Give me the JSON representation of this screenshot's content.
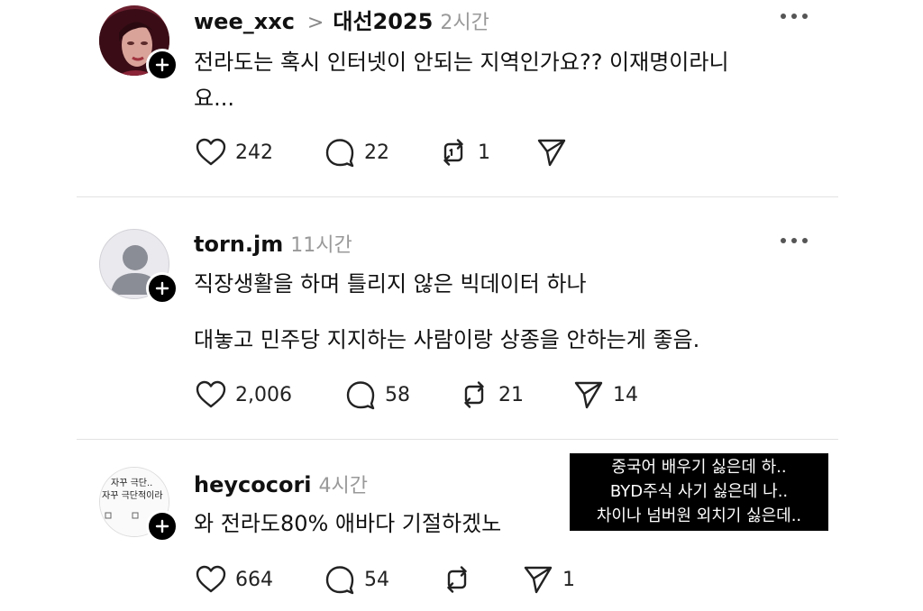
{
  "posts": [
    {
      "username": "wee_xxc",
      "topic": "대선2025",
      "time": "2시간",
      "lines": [
        "전라도는 혹시 인터넷이 안되는 지역인가요?? 이재명이라니",
        "요..."
      ],
      "likes": "242",
      "comments": "22",
      "reposts": "1",
      "shares": ""
    },
    {
      "username": "torn.jm",
      "time": "11시간",
      "lines": [
        "직장생활을 하며 틀리지 않은 빅데이터 하나",
        "대놓고 민주당 지지하는 사람이랑 상종을 안하는게 좋음."
      ],
      "likes": "2,006",
      "comments": "58",
      "reposts": "21",
      "shares": "14"
    },
    {
      "username": "heycocori",
      "time": "4시간",
      "lines": [
        "와 전라도80% 애바다 기절하겠노"
      ],
      "likes": "664",
      "comments": "54",
      "reposts": "",
      "shares": "1",
      "avatar_text": [
        "자꾸 극단..",
        "자꾸 극단적이라"
      ]
    }
  ],
  "overlay": {
    "lines": [
      "중국어 배우기 싫은데 하..",
      "BYD주식 사기 싫은데 나..",
      "차이나 넘버원 외치기 싫은데.."
    ]
  },
  "icons": {
    "like": "heart-icon",
    "comment": "comment-bubble-icon",
    "repost": "repost-icon",
    "share": "share-send-icon",
    "more": "more-options-icon",
    "follow": "plus-icon"
  }
}
